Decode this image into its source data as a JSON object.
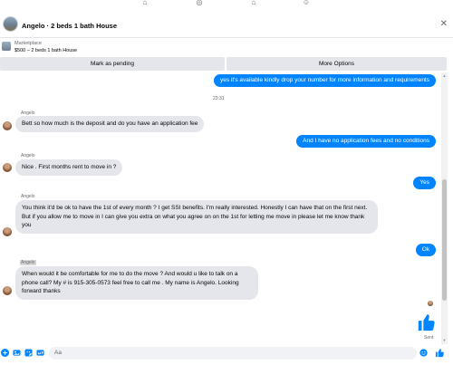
{
  "header": {
    "title": "Angelo · 2 beds 1 bath House",
    "close_glyph": "✕"
  },
  "listing": {
    "label": "Marketplace",
    "detail": "$500 – 2 beds 1 bath House"
  },
  "actions": {
    "mark_pending": "Mark as pending",
    "more_options": "More Options"
  },
  "thread": {
    "messages": [
      {
        "dir": "out",
        "text": "yes it's available kindly drop your number for more information and requirements"
      },
      {
        "dir": "ts",
        "text": "23:31"
      },
      {
        "dir": "in",
        "sender": "Angelo",
        "text": "Bett so how much is the deposit and do you have an application fee"
      },
      {
        "dir": "out",
        "text": "And I have no application fees and no conditions"
      },
      {
        "dir": "in",
        "sender": "Angelo",
        "text": "Nice . First months rent to move in ?"
      },
      {
        "dir": "out",
        "text": "Yes"
      },
      {
        "dir": "in",
        "sender": "Angelo",
        "text": "You  think it'd be ok to have  the 1st of every month ? I get SSI benefits.  I'm really interested. Honestly I can have that on the first  next. But if you allow me to move in I can give you extra on what you agree on on the 1st for letting me move in please let me know thank you"
      },
      {
        "dir": "out",
        "text": "Ok"
      },
      {
        "dir": "in",
        "sender": "Angelo",
        "text": "When would it be comfortable for me to do the move ? And would u like to talk on a phone call? My # is 915-305-0573 feel free to call me . My name is Angelo. Looking forward thanks"
      }
    ],
    "sent_label": "Sent"
  },
  "composer": {
    "placeholder": "Aa"
  },
  "colors": {
    "accent": "#0084ff",
    "bubble_in": "#e4e6eb"
  },
  "icons": [
    "home-icon",
    "marketplace-icon",
    "store-icon",
    "groups-icon",
    "close-icon",
    "plus-icon",
    "photo-icon",
    "sticker-icon",
    "gif-icon",
    "emoji-icon",
    "thumbs-up-icon"
  ]
}
